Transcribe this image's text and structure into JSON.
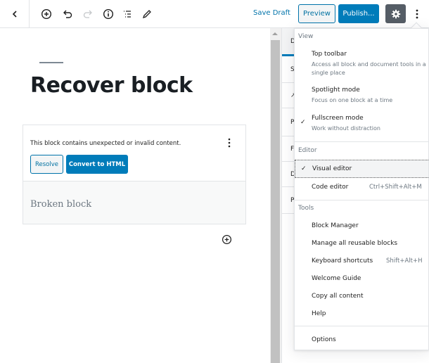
{
  "header": {
    "back_icon": "chevron-left-icon",
    "toolbar_icons": [
      "add-block-icon",
      "undo-icon",
      "redo-icon",
      "info-icon",
      "list-view-icon",
      "edit-tools-icon"
    ],
    "save_draft": "Save Draft",
    "preview": "Preview",
    "publish": "Publish...",
    "settings_icon": "gear-icon",
    "more_icon": "more-vertical-icon"
  },
  "editor": {
    "title": "Recover block",
    "warning_message": "This block contains unexpected or invalid content.",
    "resolve": "Resolve",
    "convert": "Convert to HTML",
    "broken_content": "Broken block"
  },
  "sidebar": {
    "tabs": [
      "D",
      "S",
      "↗",
      "P",
      "F",
      "D",
      "P"
    ]
  },
  "menu": {
    "view": {
      "label": "View",
      "items": [
        {
          "label": "Top toolbar",
          "description": "Access all block and document tools in a single place",
          "checked": false
        },
        {
          "label": "Spotlight mode",
          "description": "Focus on one block at a time",
          "checked": false
        },
        {
          "label": "Fullscreen mode",
          "description": "Work without distraction",
          "checked": true
        }
      ]
    },
    "editor": {
      "label": "Editor",
      "items": [
        {
          "label": "Visual editor",
          "shortcut": "",
          "checked": true
        },
        {
          "label": "Code editor",
          "shortcut": "Ctrl+Shift+Alt+M",
          "checked": false
        }
      ]
    },
    "tools": {
      "label": "Tools",
      "items": [
        {
          "label": "Block Manager",
          "shortcut": ""
        },
        {
          "label": "Manage all reusable blocks",
          "shortcut": ""
        },
        {
          "label": "Keyboard shortcuts",
          "shortcut": "Shift+Alt+H"
        },
        {
          "label": "Welcome Guide",
          "shortcut": ""
        },
        {
          "label": "Copy all content",
          "shortcut": ""
        },
        {
          "label": "Help",
          "shortcut": ""
        }
      ]
    },
    "options": "Options",
    "check_glyph": "✓"
  },
  "colors": {
    "accent": "#007cba",
    "accent_text": "#0071a1",
    "settings_bg": "#555d66",
    "muted": "#6c7781"
  }
}
